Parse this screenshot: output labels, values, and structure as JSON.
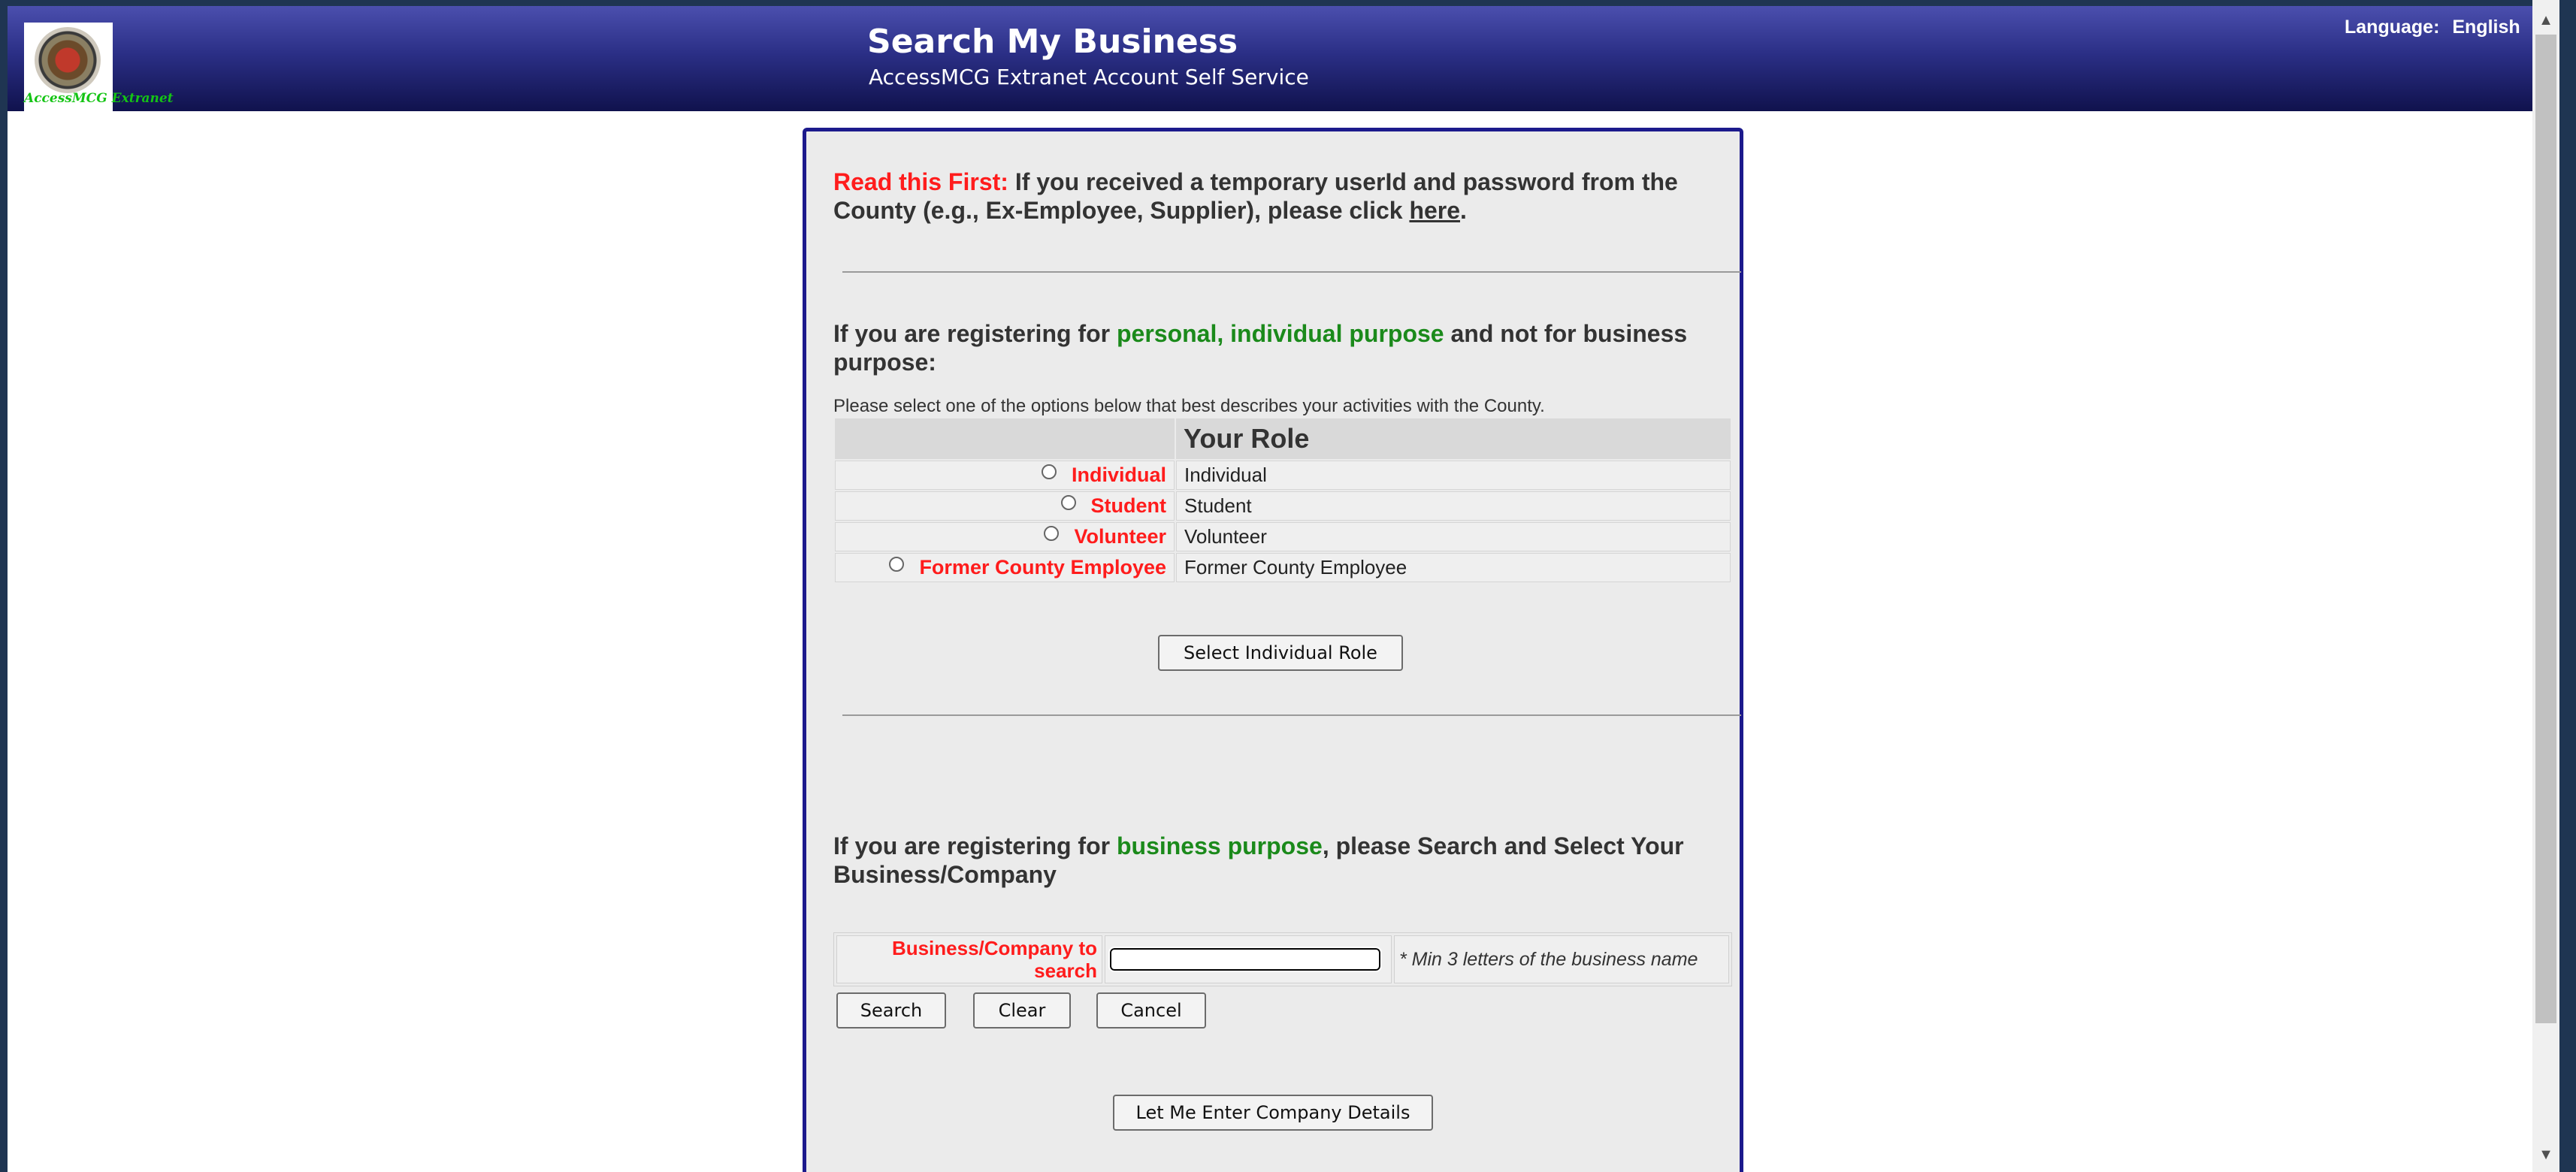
{
  "header": {
    "logo_text": "AccessMCG Extranet",
    "title": "Search My Business",
    "subtitle": "AccessMCG Extranet Account Self Service",
    "language_label": "Language:",
    "language_value": "English"
  },
  "notice": {
    "lead": "Read this First:",
    "text": " If you received a temporary userId and password from the County (e.g., Ex-Employee, Supplier), please click ",
    "link": "here",
    "end": "."
  },
  "personal": {
    "intro_pre": "If you are registering for ",
    "intro_highlight": "personal, individual purpose",
    "intro_post": " and not for business purpose:",
    "instruction": "Please select one of the options below that best describes your activities with the County.",
    "table_header": "Your Role",
    "roles": [
      {
        "option": "Individual",
        "role": "Individual"
      },
      {
        "option": "Student",
        "role": "Student"
      },
      {
        "option": "Volunteer",
        "role": "Volunteer"
      },
      {
        "option": "Former County Employee",
        "role": "Former County Employee"
      }
    ],
    "select_button": "Select Individual Role"
  },
  "business": {
    "intro_pre": "If you are registering for ",
    "intro_highlight": "business purpose",
    "intro_post": ", please Search and Select Your Business/Company",
    "search_label": "Business/Company to search",
    "search_value": "",
    "hint": "* Min 3 letters of the business name",
    "buttons": {
      "search": "Search",
      "clear": "Clear",
      "cancel": "Cancel"
    },
    "enter_details_button": "Let Me Enter Company Details"
  },
  "colors": {
    "header_top": "#4b4fae",
    "header_bottom": "#10124d",
    "panel_border": "#1c1a8c",
    "required_red": "#ff1c1c",
    "highlight_green": "#1b8a1b"
  }
}
